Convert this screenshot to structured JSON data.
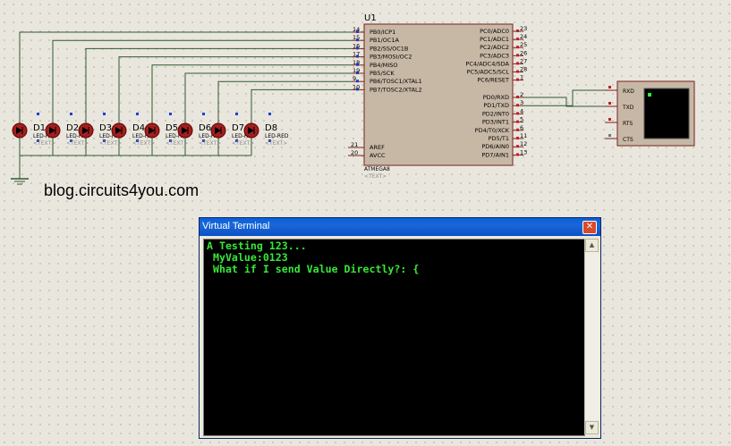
{
  "schematic": {
    "mcu": {
      "ref": "U1",
      "part": "ATMEGA8",
      "text": "<TEXT>",
      "left_pins": [
        {
          "num": "14",
          "name": "PB0/ICP1"
        },
        {
          "num": "15",
          "name": "PB1/OC1A"
        },
        {
          "num": "16",
          "name": "PB2/SS/OC1B"
        },
        {
          "num": "17",
          "name": "PB3/MOSI/OC2"
        },
        {
          "num": "18",
          "name": "PB4/MISO"
        },
        {
          "num": "19",
          "name": "PB5/SCK"
        },
        {
          "num": "9",
          "name": "PB6/TOSC1/XTAL1"
        },
        {
          "num": "10",
          "name": "PB7/TOSC2/XTAL2"
        }
      ],
      "power_pins": [
        {
          "num": "21",
          "name": "AREF"
        },
        {
          "num": "20",
          "name": "AVCC"
        }
      ],
      "right_pins": [
        {
          "num": "23",
          "name": "PC0/ADC0"
        },
        {
          "num": "24",
          "name": "PC1/ADC1"
        },
        {
          "num": "25",
          "name": "PC2/ADC2"
        },
        {
          "num": "26",
          "name": "PC3/ADC3"
        },
        {
          "num": "27",
          "name": "PC4/ADC4/SDA"
        },
        {
          "num": "28",
          "name": "PC5/ADC5/SCL"
        },
        {
          "num": "1",
          "name": "PC6/RESET"
        },
        {
          "num": "2",
          "name": "PD0/RXD"
        },
        {
          "num": "3",
          "name": "PD1/TXD"
        },
        {
          "num": "4",
          "name": "PD2/INT0"
        },
        {
          "num": "5",
          "name": "PD3/INT1"
        },
        {
          "num": "6",
          "name": "PD4/T0/XCK"
        },
        {
          "num": "11",
          "name": "PD5/T1"
        },
        {
          "num": "12",
          "name": "PD6/AIN0"
        },
        {
          "num": "13",
          "name": "PD7/AIN1"
        }
      ]
    },
    "leds": [
      {
        "ref": "D1",
        "part": "LED-RED",
        "text": "<TEXT>"
      },
      {
        "ref": "D2",
        "part": "LED-RED",
        "text": "<TEXT>"
      },
      {
        "ref": "D3",
        "part": "LED-RED",
        "text": "<TEXT>"
      },
      {
        "ref": "D4",
        "part": "LED-RED",
        "text": "<TEXT>"
      },
      {
        "ref": "D5",
        "part": "LED-RED",
        "text": "<TEXT>"
      },
      {
        "ref": "D6",
        "part": "LED-RED",
        "text": "<TEXT>"
      },
      {
        "ref": "D7",
        "part": "LED-RED",
        "text": "<TEXT>"
      },
      {
        "ref": "D8",
        "part": "LED-RED",
        "text": "<TEXT>"
      }
    ],
    "terminal_component": {
      "pins": [
        "RXD",
        "TXD",
        "RTS",
        "CTS"
      ]
    }
  },
  "watermark": "blog.circuits4you.com",
  "virtual_terminal": {
    "title": "Virtual Terminal",
    "close_glyph": "✕",
    "lines": [
      "A Testing 123...",
      " MyValue:0123",
      " What if I send Value Directly?: {"
    ]
  }
}
